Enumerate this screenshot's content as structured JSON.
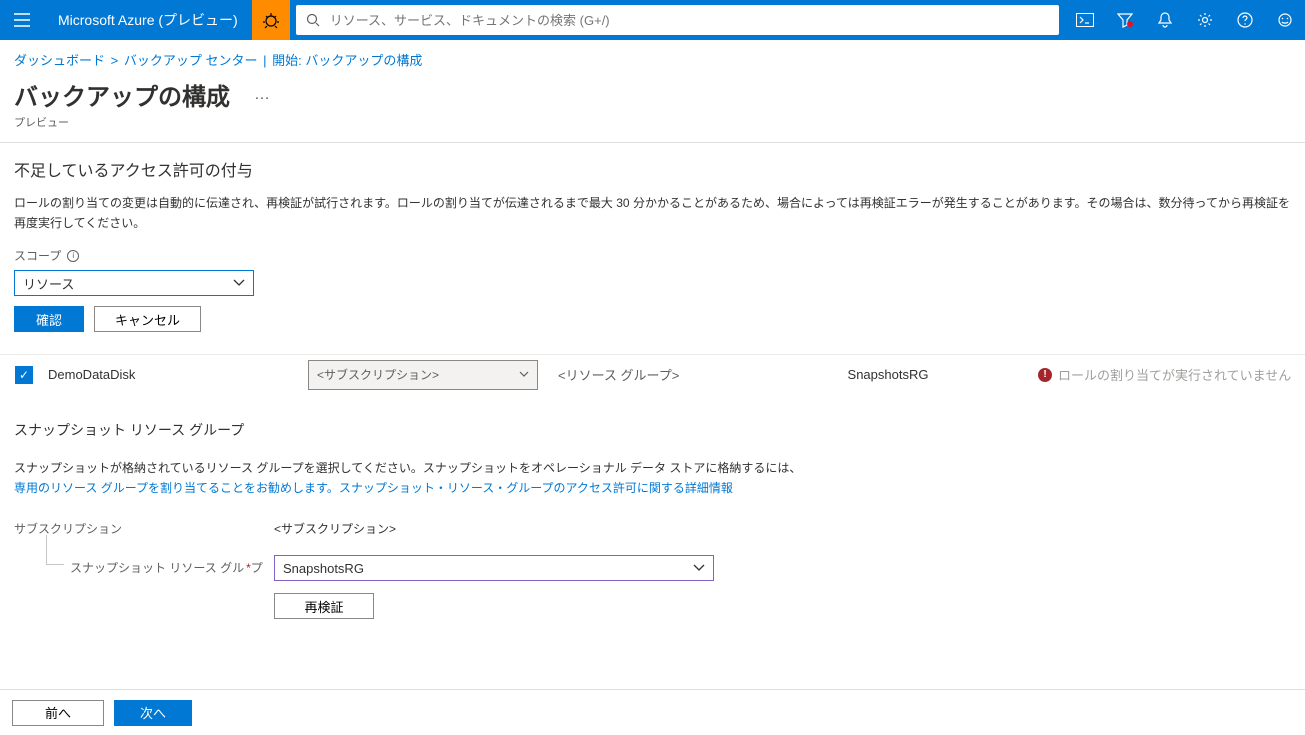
{
  "header": {
    "brand": "Microsoft Azure (プレビュー)",
    "search_placeholder": "リソース、サービス、ドキュメントの検索 (G+/)"
  },
  "breadcrumb": {
    "item1": "ダッシュボード",
    "item2": "バックアップ センター",
    "item3": "開始: バックアップの構成"
  },
  "page": {
    "title": "バックアップの構成",
    "more": "…",
    "subtitle": "プレビュー"
  },
  "perm": {
    "heading": "不足しているアクセス許可の付与",
    "body": "ロールの割り当ての変更は自動的に伝達され、再検証が試行されます。ロールの割り当てが伝達されるまで最大 30 分かかることがあるため、場合によっては再検証エラーが発生することがあります。その場合は、数分待ってから再検証を再度実行してください。",
    "scope_label": "スコープ",
    "scope_value": "リソース",
    "confirm": "確認",
    "cancel": "キャンセル"
  },
  "row": {
    "name": "DemoDataDisk",
    "subscription": "<サブスクリプション>",
    "rg": "<リソース グループ>",
    "snap_rg": "SnapshotsRG",
    "status": "ロールの割り当てが実行されていません"
  },
  "snap": {
    "heading": "スナップショット リソース グループ",
    "desc1": "スナップショットが格納されているリソース グループを選択してください。スナップショットをオペレーショナル データ ストアに格納するには、",
    "link": "専用のリソース グループを割り当てることをお勧めします。スナップショット・リソース・グループのアクセス許可に関する詳細情報",
    "sub_label": "サブスクリプション",
    "sub_value": "<サブスクリプション>",
    "rg_label": "スナップショット リソース グル",
    "rg_value": "SnapshotsRG",
    "revalidate": "再検証"
  },
  "footer": {
    "prev": "前へ",
    "next": "次へ"
  }
}
